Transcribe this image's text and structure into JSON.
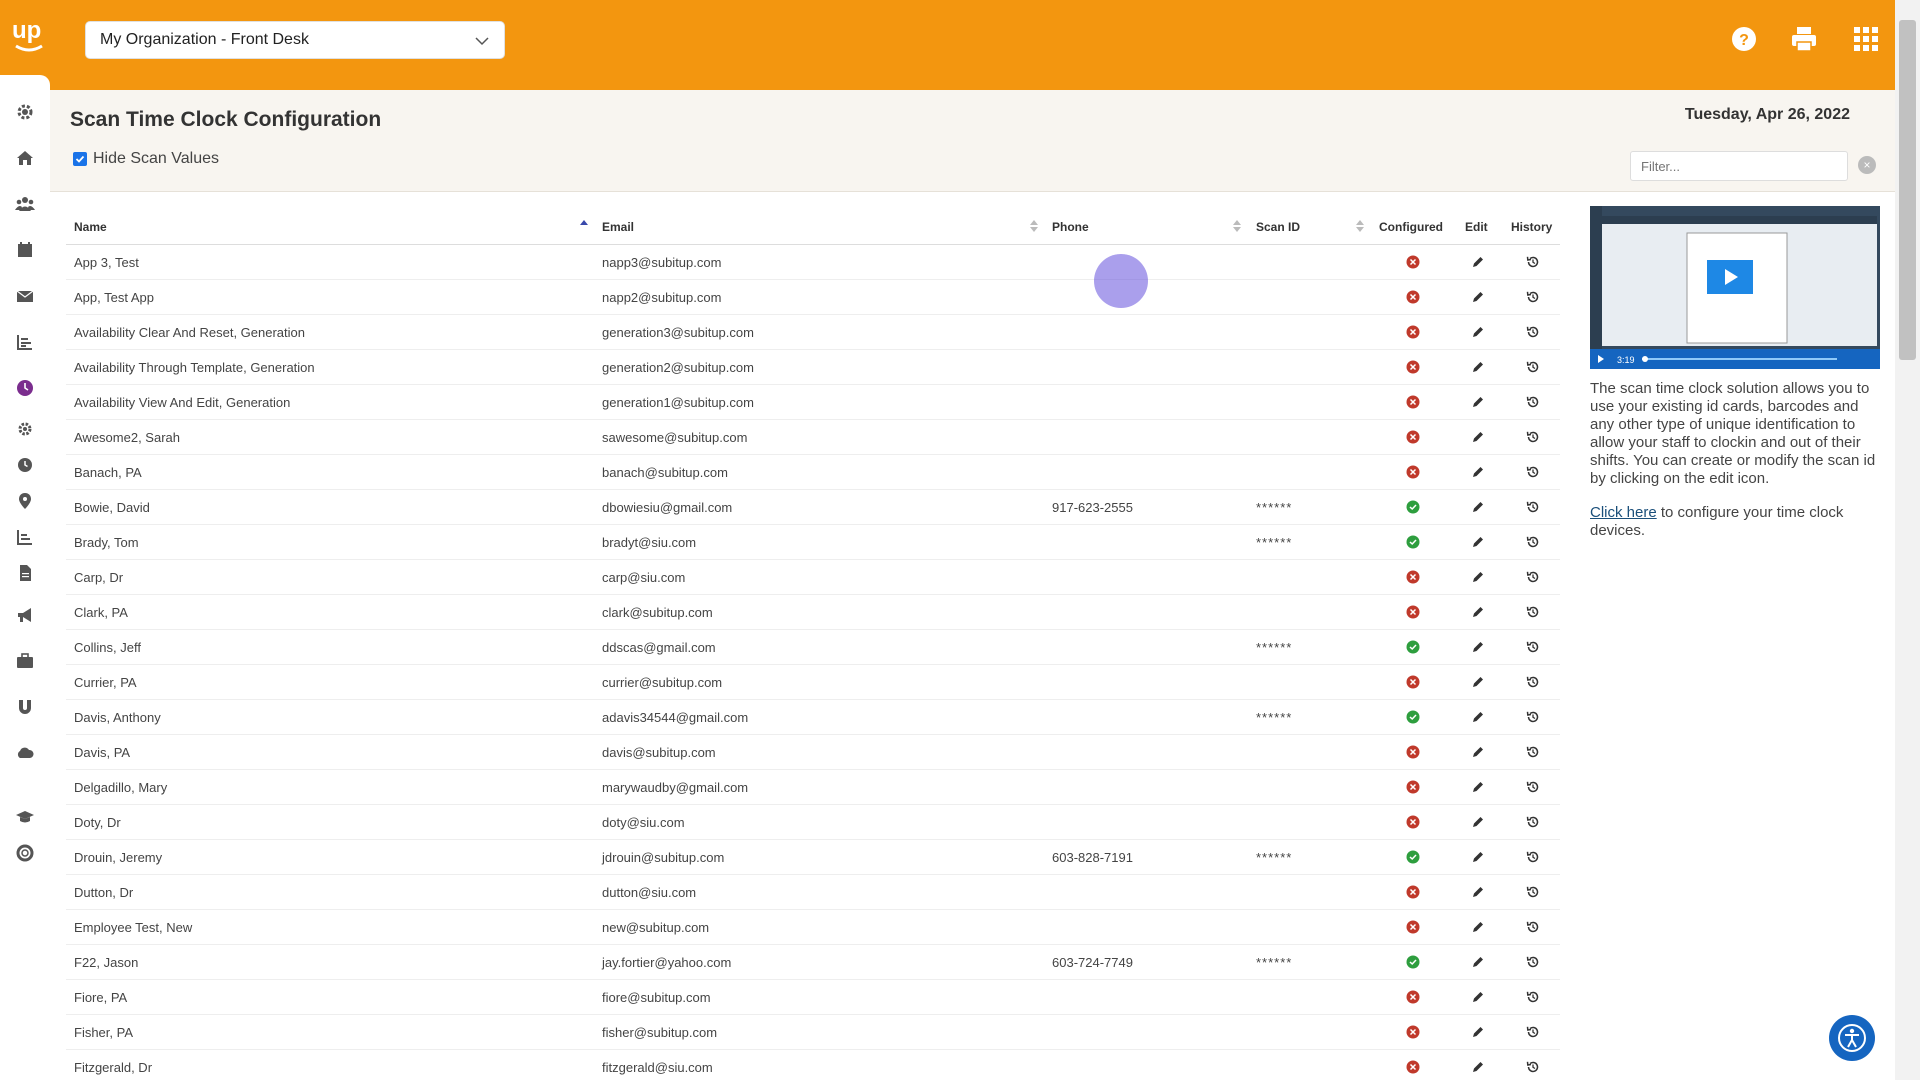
{
  "header": {
    "org_select": "My Organization - Front Desk",
    "icons": [
      "help-icon",
      "print-icon",
      "apps-grid-icon"
    ]
  },
  "page": {
    "title": "Scan Time Clock Configuration",
    "date": "Tuesday, Apr 26, 2022",
    "hide_scan_label": "Hide Scan Values",
    "hide_scan_checked": true,
    "filter_placeholder": "Filter..."
  },
  "table": {
    "columns": {
      "name": "Name",
      "email": "Email",
      "phone": "Phone",
      "scan_id": "Scan ID",
      "configured": "Configured",
      "edit": "Edit",
      "history": "History"
    },
    "rows": [
      {
        "name": "App 3, Test",
        "email": "napp3@subitup.com",
        "phone": "",
        "scan": "",
        "configured": false
      },
      {
        "name": "App, Test App",
        "email": "napp2@subitup.com",
        "phone": "",
        "scan": "",
        "configured": false
      },
      {
        "name": "Availability Clear And Reset, Generation",
        "email": "generation3@subitup.com",
        "phone": "",
        "scan": "",
        "configured": false
      },
      {
        "name": "Availability Through Template, Generation",
        "email": "generation2@subitup.com",
        "phone": "",
        "scan": "",
        "configured": false
      },
      {
        "name": "Availability View And Edit, Generation",
        "email": "generation1@subitup.com",
        "phone": "",
        "scan": "",
        "configured": false
      },
      {
        "name": "Awesome2, Sarah",
        "email": "sawesome@subitup.com",
        "phone": "",
        "scan": "",
        "configured": false
      },
      {
        "name": "Banach, PA",
        "email": "banach@subitup.com",
        "phone": "",
        "scan": "",
        "configured": false
      },
      {
        "name": "Bowie, David",
        "email": "dbowiesiu@gmail.com",
        "phone": "917-623-2555",
        "scan": "******",
        "configured": true
      },
      {
        "name": "Brady, Tom",
        "email": "bradyt@siu.com",
        "phone": "",
        "scan": "******",
        "configured": true
      },
      {
        "name": "Carp, Dr",
        "email": "carp@siu.com",
        "phone": "",
        "scan": "",
        "configured": false
      },
      {
        "name": "Clark, PA",
        "email": "clark@subitup.com",
        "phone": "",
        "scan": "",
        "configured": false
      },
      {
        "name": "Collins, Jeff",
        "email": "ddscas@gmail.com",
        "phone": "",
        "scan": "******",
        "configured": true
      },
      {
        "name": "Currier, PA",
        "email": "currier@subitup.com",
        "phone": "",
        "scan": "",
        "configured": false
      },
      {
        "name": "Davis, Anthony",
        "email": "adavis34544@gmail.com",
        "phone": "",
        "scan": "******",
        "configured": true
      },
      {
        "name": "Davis, PA",
        "email": "davis@subitup.com",
        "phone": "",
        "scan": "",
        "configured": false
      },
      {
        "name": "Delgadillo, Mary",
        "email": "marywaudby@gmail.com",
        "phone": "",
        "scan": "",
        "configured": false
      },
      {
        "name": "Doty, Dr",
        "email": "doty@siu.com",
        "phone": "",
        "scan": "",
        "configured": false
      },
      {
        "name": "Drouin, Jeremy",
        "email": "jdrouin@subitup.com",
        "phone": "603-828-7191",
        "scan": "******",
        "configured": true
      },
      {
        "name": "Dutton, Dr",
        "email": "dutton@siu.com",
        "phone": "",
        "scan": "",
        "configured": false
      },
      {
        "name": "Employee Test, New",
        "email": "new@subitup.com",
        "phone": "",
        "scan": "",
        "configured": false
      },
      {
        "name": "F22, Jason",
        "email": "jay.fortier@yahoo.com",
        "phone": "603-724-7749",
        "scan": "******",
        "configured": true
      },
      {
        "name": "Fiore, PA",
        "email": "fiore@subitup.com",
        "phone": "",
        "scan": "",
        "configured": false
      },
      {
        "name": "Fisher, PA",
        "email": "fisher@subitup.com",
        "phone": "",
        "scan": "",
        "configured": false
      },
      {
        "name": "Fitzgerald, Dr",
        "email": "fitzgerald@siu.com",
        "phone": "",
        "scan": "",
        "configured": false
      }
    ]
  },
  "panel": {
    "video_time": "3:19",
    "description": "The scan time clock solution allows you to use your existing id cards, barcodes and any other type of unique identification to allow your staff to clockin and out of their shifts. You can create or modify the scan id by clicking on the edit icon.",
    "link_text": "Click here",
    "link_suffix": " to configure your time clock devices."
  },
  "colors": {
    "brand": "#f3960f",
    "configured_yes": "#2e9e3e",
    "configured_no": "#c0392b",
    "active_nav": "#7b2d8e"
  },
  "sidebar_icons": [
    "settings-icon",
    "home-icon",
    "people-icon",
    "calendar-icon",
    "mail-icon",
    "reports-icon",
    "clock-icon",
    "gear-icon",
    "history-clock-icon",
    "location-pin-icon",
    "chart-icon",
    "document-icon",
    "megaphone-icon",
    "briefcase-icon",
    "magnet-icon",
    "cloud-icon",
    "graduation-cap-icon",
    "support-icon"
  ]
}
